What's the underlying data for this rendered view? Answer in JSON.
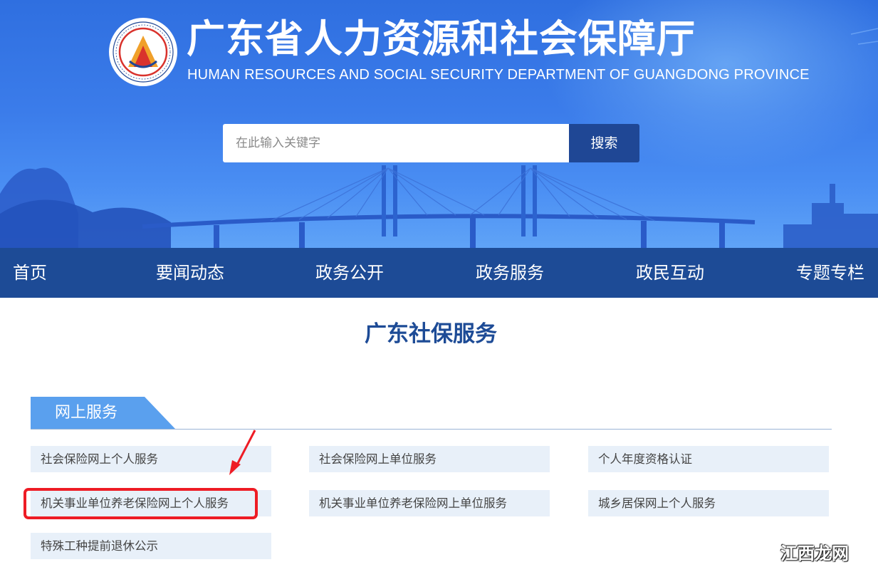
{
  "header": {
    "title_cn": "广东省人力资源和社会保障厅",
    "title_en": "HUMAN RESOURCES AND SOCIAL SECURITY DEPARTMENT OF GUANGDONG PROVINCE",
    "logo_icon": "gd-hrss-emblem-icon"
  },
  "search": {
    "placeholder": "在此输入关键字",
    "value": "",
    "button_label": "搜索"
  },
  "nav": {
    "items": [
      {
        "label": "首页"
      },
      {
        "label": "要闻动态"
      },
      {
        "label": "政务公开"
      },
      {
        "label": "政务服务"
      },
      {
        "label": "政民互动"
      },
      {
        "label": "专题专栏"
      }
    ]
  },
  "main": {
    "title": "广东社保服务",
    "section_label": "网上服务",
    "links": [
      "社会保险网上个人服务",
      "社会保险网上单位服务",
      "个人年度资格认证",
      "机关事业单位养老保险网上个人服务",
      "机关事业单位养老保险网上单位服务",
      "城乡居保网上个人服务",
      "特殊工种提前退休公示"
    ]
  },
  "annotation": {
    "highlight_color": "#ee1c25",
    "highlighted_link_index": 3
  },
  "watermark": {
    "text": "江西龙网"
  },
  "colors": {
    "nav_bg": "#1d4b96",
    "accent_blue": "#1d4b96",
    "banner_blue": "#3b7cea",
    "link_bg": "#e8f0f9",
    "section_tab": "#5aa0ee"
  }
}
